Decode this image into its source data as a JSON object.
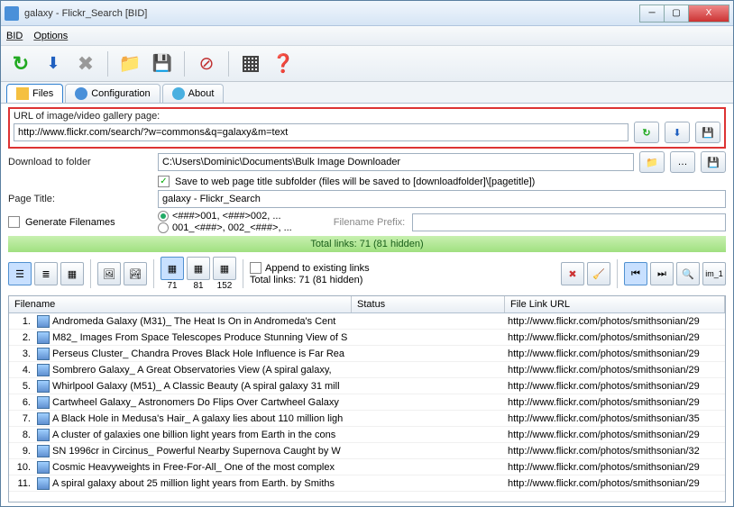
{
  "window": {
    "title": "galaxy - Flickr_Search [BID]"
  },
  "menu": {
    "bid": "BID",
    "options": "Options"
  },
  "tabs": {
    "files": "Files",
    "config": "Configuration",
    "about": "About"
  },
  "url": {
    "label": "URL of image/video gallery page:",
    "value": "http://www.flickr.com/search/?w=commons&q=galaxy&m=text"
  },
  "download": {
    "label": "Download to folder",
    "path": "C:\\Users\\Dominic\\Documents\\Bulk Image Downloader",
    "subfolder_label": "Save to web page title subfolder (files will be saved to [downloadfolder]\\[pagetitle])"
  },
  "page_title": {
    "label": "Page Title:",
    "value": "galaxy - Flickr_Search"
  },
  "generate": {
    "label": "Generate Filenames"
  },
  "radio": {
    "opt1": "<###>001, <###>002, ...",
    "opt2": "001_<###>, 002_<###>, ..."
  },
  "filename_prefix": {
    "label": "Filename Prefix:",
    "value": ""
  },
  "statusbar": "Total links: 71 (81 hidden)",
  "append": "Append to existing links",
  "counts": {
    "c1": "71",
    "c2": "81",
    "c3": "152"
  },
  "totals2": "Total links: 71 (81 hidden)",
  "im1": "im_1",
  "columns": {
    "filename": "Filename",
    "status": "Status",
    "url": "File Link URL"
  },
  "rows": [
    {
      "n": "1.",
      "fn": "Andromeda Galaxy (M31)_ The Heat Is On in Andromeda's Cent",
      "url": "http://www.flickr.com/photos/smithsonian/29"
    },
    {
      "n": "2.",
      "fn": "M82_ Images From Space Telescopes Produce Stunning View of S",
      "url": "http://www.flickr.com/photos/smithsonian/29"
    },
    {
      "n": "3.",
      "fn": "Perseus Cluster_ Chandra Proves Black Hole Influence is Far Rea",
      "url": "http://www.flickr.com/photos/smithsonian/29"
    },
    {
      "n": "4.",
      "fn": "Sombrero Galaxy_ A Great Observatories View (A spiral galaxy,",
      "url": "http://www.flickr.com/photos/smithsonian/29"
    },
    {
      "n": "5.",
      "fn": "Whirlpool Galaxy (M51)_ A Classic Beauty (A spiral galaxy 31 mill",
      "url": "http://www.flickr.com/photos/smithsonian/29"
    },
    {
      "n": "6.",
      "fn": "Cartwheel Galaxy_ Astronomers Do Flips Over Cartwheel Galaxy",
      "url": "http://www.flickr.com/photos/smithsonian/29"
    },
    {
      "n": "7.",
      "fn": "A Black Hole in Medusa's Hair_ A galaxy lies about 110 million ligh",
      "url": "http://www.flickr.com/photos/smithsonian/35"
    },
    {
      "n": "8.",
      "fn": "A cluster of galaxies one billion light years from Earth in the cons",
      "url": "http://www.flickr.com/photos/smithsonian/29"
    },
    {
      "n": "9.",
      "fn": "SN 1996cr in Circinus_ Powerful Nearby Supernova Caught by W",
      "url": "http://www.flickr.com/photos/smithsonian/32"
    },
    {
      "n": "10.",
      "fn": "Cosmic Heavyweights in Free-For-All_ One of the most complex",
      "url": "http://www.flickr.com/photos/smithsonian/29"
    },
    {
      "n": "11.",
      "fn": "A spiral galaxy about 25 million light years from Earth. by Smiths",
      "url": "http://www.flickr.com/photos/smithsonian/29"
    }
  ]
}
